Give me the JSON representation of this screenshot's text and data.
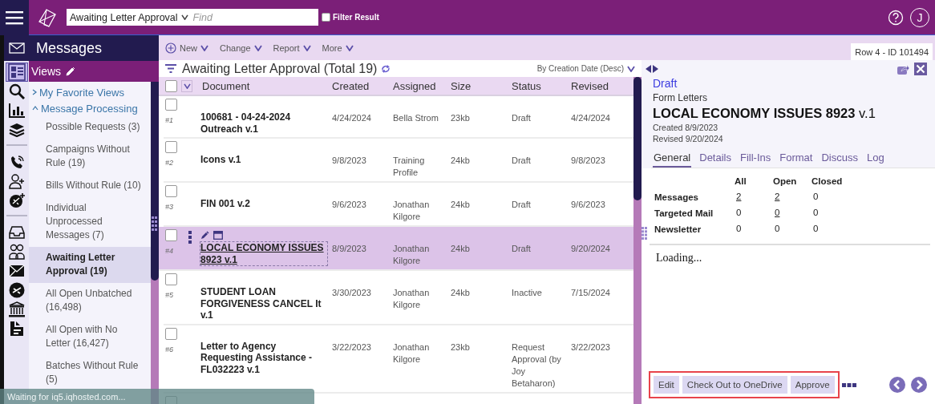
{
  "top_bar": {
    "view_select": {
      "value": "Awaiting Letter Approval"
    },
    "search": {
      "placeholder": "Find"
    },
    "filter_result": {
      "label": "Filter Result",
      "checked": false
    },
    "user": {
      "initial": "J"
    }
  },
  "sidebar": {
    "title": "Messages",
    "views_label": "Views",
    "rail": [
      {
        "kind": "views",
        "selected": true
      },
      {
        "kind": "search",
        "selected": false
      },
      {
        "kind": "chart",
        "selected": false
      },
      {
        "kind": "layers",
        "selected": false
      },
      {
        "kind": "divider"
      },
      {
        "kind": "phone",
        "selected": false
      },
      {
        "kind": "person-add",
        "selected": false
      },
      {
        "kind": "badge-add",
        "selected": false
      },
      {
        "kind": "divider"
      },
      {
        "kind": "inbox",
        "selected": false
      },
      {
        "kind": "people",
        "selected": false
      },
      {
        "kind": "envelope",
        "selected": false
      },
      {
        "kind": "slash",
        "selected": false
      },
      {
        "kind": "bank",
        "selected": false
      },
      {
        "kind": "report",
        "selected": false
      }
    ],
    "tree": [
      {
        "label": "My Favorite Views",
        "expanded": false
      },
      {
        "label": "Message Processing",
        "expanded": true,
        "children": [
          {
            "label": "Possible Requests (3)",
            "selected": false
          },
          {
            "label": "Campaigns Without Rule (19)",
            "selected": false
          },
          {
            "label": "Bills Without Rule (10)",
            "selected": false
          },
          {
            "label": "Individual Unprocessed Messages (7)",
            "selected": false
          },
          {
            "label": "Awaiting Letter Approval (19)",
            "selected": true
          },
          {
            "label": "All Open Unbatched (16,498)",
            "selected": false
          },
          {
            "label": "All Open with No Letter (16,427)",
            "selected": false
          },
          {
            "label": "Batches Without Rule (5)",
            "selected": false
          }
        ]
      }
    ]
  },
  "toolbar": {
    "actions": [
      {
        "label": "New",
        "kind": "add"
      },
      {
        "label": "Change",
        "kind": "menu"
      },
      {
        "label": "Report",
        "kind": "menu"
      },
      {
        "label": "More",
        "kind": "menu"
      }
    ],
    "row_tab": "Row 4 - ID 101494"
  },
  "list": {
    "title": "Awaiting Letter Approval (Total 19)",
    "sort": "By Creation Date (Desc)",
    "all_checked": false,
    "columns": [
      "Document",
      "Created",
      "Assigned",
      "Size",
      "Status",
      "Revised"
    ],
    "rows": [
      {
        "number": "#1",
        "document": "100681 - 04-24-2024 Outreach v.1",
        "created": "4/24/2024",
        "assigned": "Bella Strom",
        "size": "23kb",
        "status": "Draft",
        "revised": "4/24/2024",
        "checked": false,
        "selected": false
      },
      {
        "number": "#2",
        "document": "Icons v.1",
        "created": "9/8/2023",
        "assigned": "Training Profile",
        "size": "24kb",
        "status": "Draft",
        "revised": "9/8/2023",
        "checked": false,
        "selected": false
      },
      {
        "number": "#3",
        "document": "FIN 001 v.2",
        "created": "9/6/2023",
        "assigned": "Jonathan Kilgore",
        "size": "24kb",
        "status": "Draft",
        "revised": "9/6/2023",
        "checked": false,
        "selected": false
      },
      {
        "number": "#4",
        "document": "LOCAL ECONOMY ISSUES 8923 v.1",
        "created": "8/9/2023",
        "assigned": "Jonathan Kilgore",
        "size": "24kb",
        "status": "Draft",
        "revised": "9/20/2024",
        "checked": false,
        "selected": true
      },
      {
        "number": "#5",
        "document": "STUDENT LOAN FORGIVENESS CANCEL It v.1",
        "created": "3/30/2023",
        "assigned": "Jonathan Kilgore",
        "size": "24kb",
        "status": "Inactive",
        "revised": "7/15/2024",
        "checked": false,
        "selected": false
      },
      {
        "number": "#6",
        "document": "Letter to Agency Requesting Assistance - FL032223 v.1",
        "created": "3/22/2023",
        "assigned": "Jonathan Kilgore",
        "size": "23kb",
        "status": "Request Approval (by Joy Betaharon)",
        "revised": "3/22/2023",
        "checked": false,
        "selected": false
      }
    ],
    "partial_row": {
      "checked": false
    }
  },
  "detail": {
    "status": "Draft",
    "category": "Form Letters",
    "title": "**LOCAL ECONOMY ISSUES 8923** v.1",
    "created": "Created 8/9/2023",
    "revised": "Revised 9/20/2024",
    "tabs": [
      {
        "label": "General",
        "selected": true
      },
      {
        "label": "Details",
        "selected": false
      },
      {
        "label": "Fill-Ins",
        "selected": false
      },
      {
        "label": "Format",
        "selected": false
      },
      {
        "label": "Discuss",
        "selected": false
      },
      {
        "label": "Log",
        "selected": false
      }
    ],
    "stats": {
      "columns": [
        "All",
        "Open",
        "Closed"
      ],
      "rows": [
        {
          "label": "Messages",
          "cells": [
            {
              "value": "2",
              "link": true
            },
            {
              "value": "2",
              "link": true
            },
            {
              "value": "0",
              "link": false
            }
          ]
        },
        {
          "label": "Targeted Mail",
          "cells": [
            {
              "value": "0",
              "link": false
            },
            {
              "value": "0",
              "link": true
            },
            {
              "value": "0",
              "link": false
            }
          ]
        },
        {
          "label": "Newsletter",
          "cells": [
            {
              "value": "0",
              "link": false
            },
            {
              "value": "0",
              "link": false
            },
            {
              "value": "0",
              "link": false
            }
          ]
        }
      ]
    },
    "body": "Loading...",
    "buttons": [
      "Edit",
      "Check Out to OneDrive",
      "Approve"
    ],
    "buttons_highlighted": true
  },
  "status_toast": "Waiting for iq5.iqhosted.com..."
}
